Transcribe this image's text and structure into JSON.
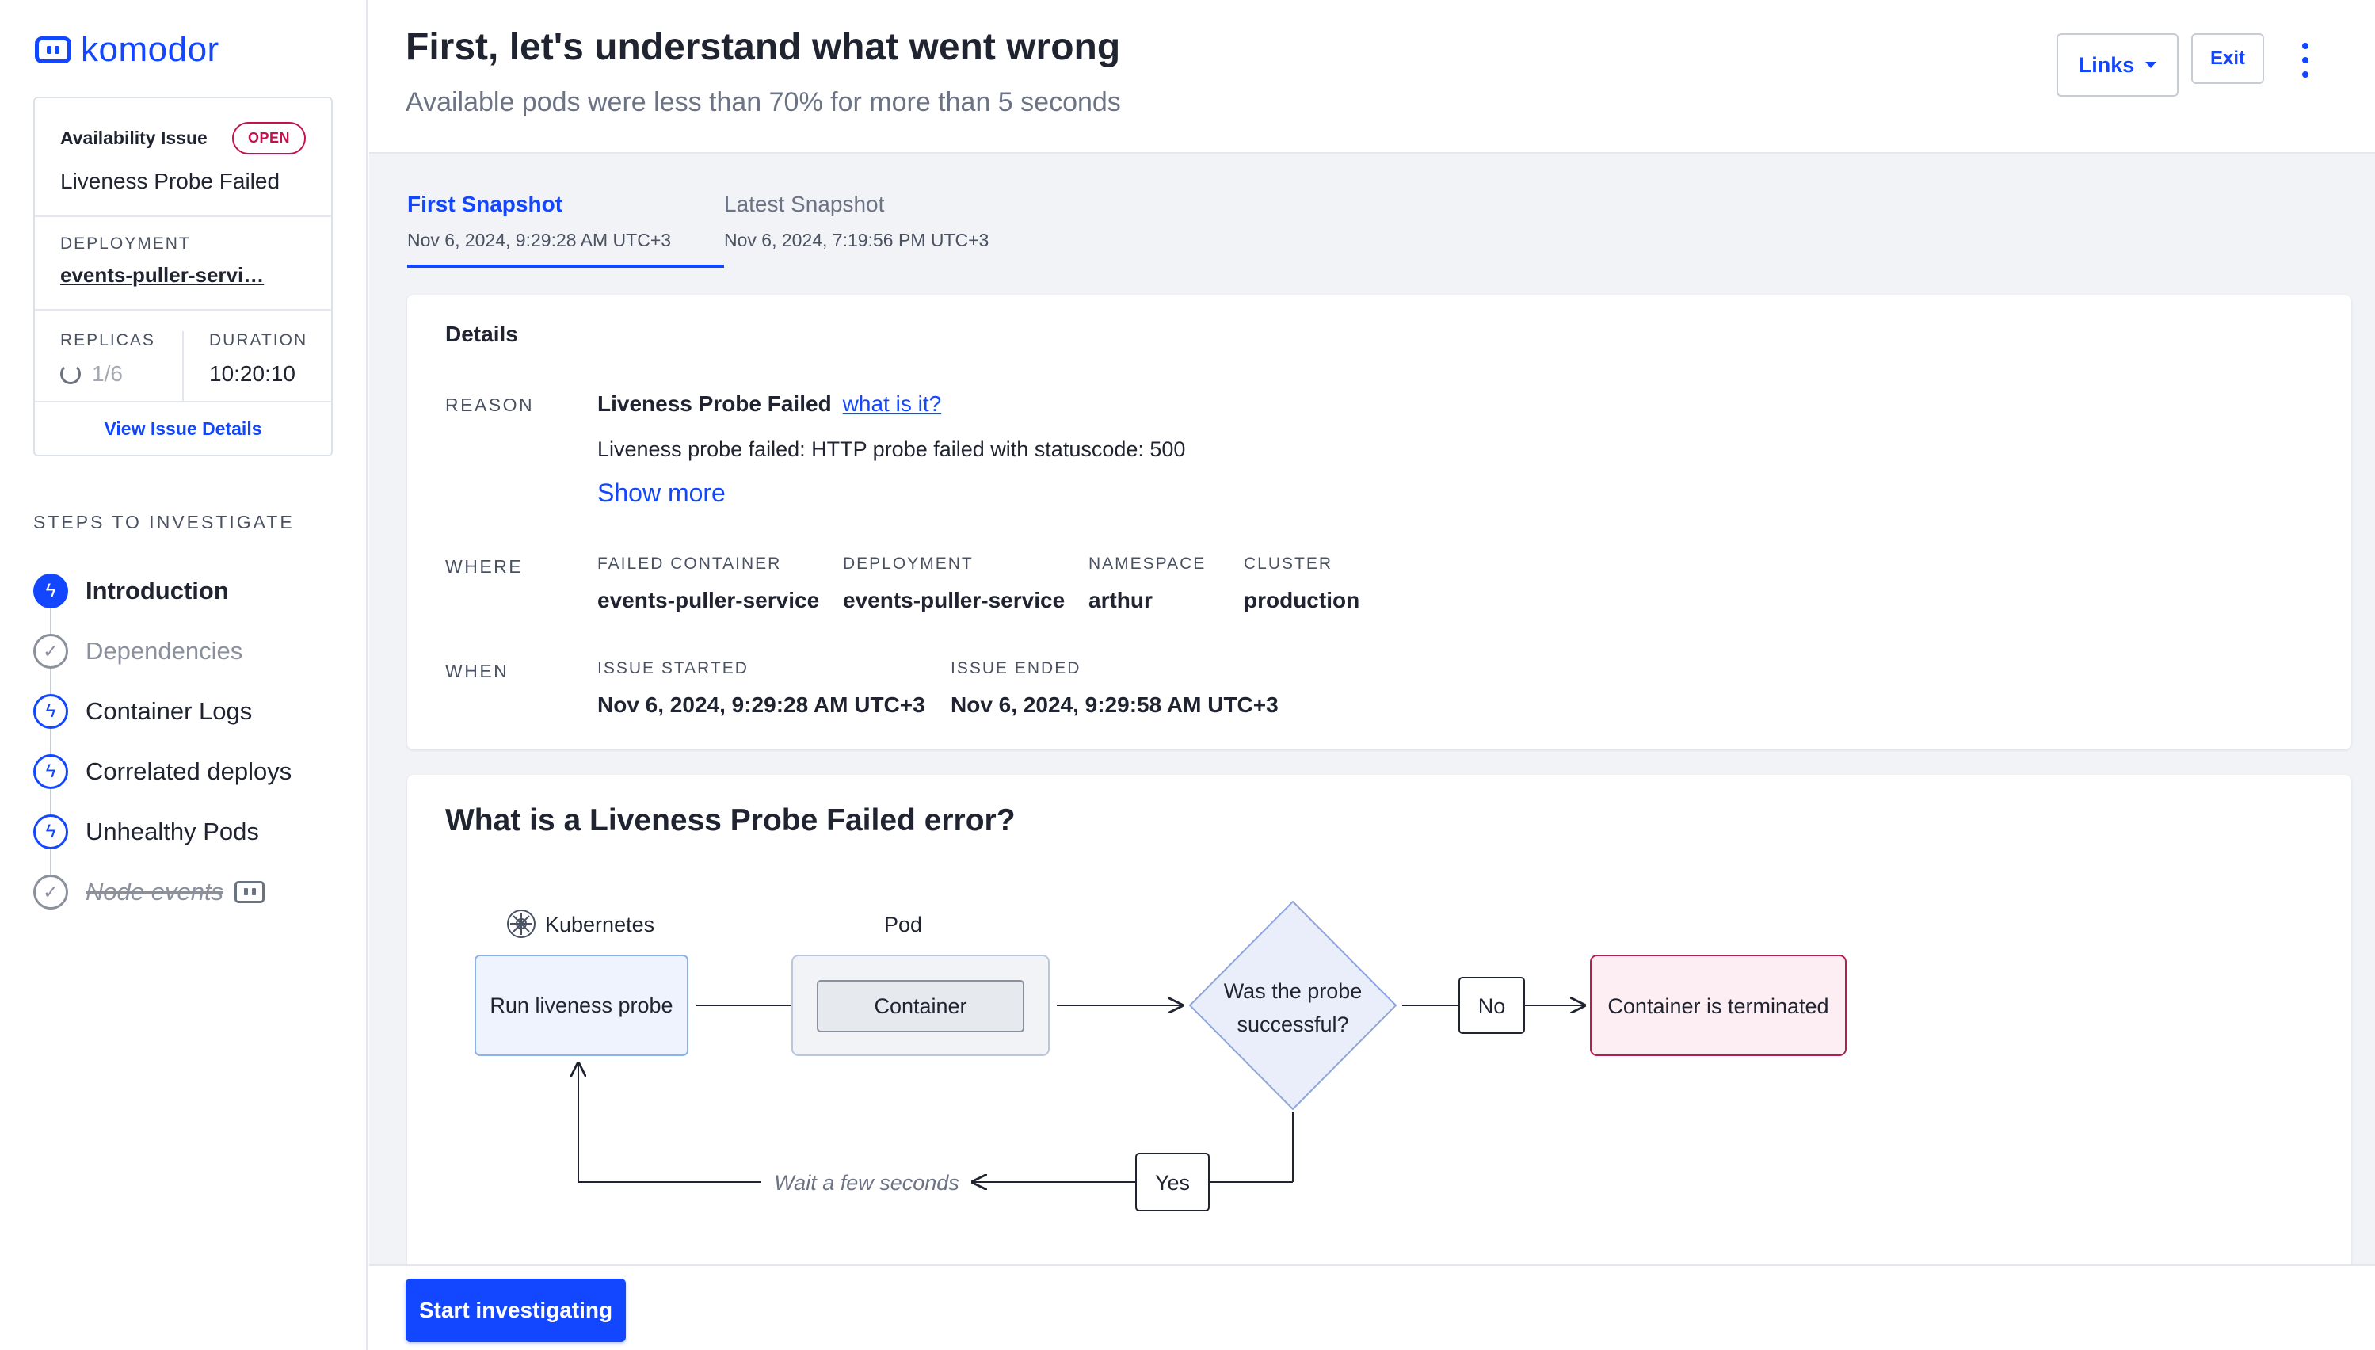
{
  "brand": {
    "name": "komodor"
  },
  "issue_card": {
    "type": "Availability Issue",
    "status": "OPEN",
    "title": "Liveness Probe Failed",
    "deployment_label": "DEPLOYMENT",
    "deployment_value": "events-puller-servi…",
    "replicas_label": "REPLICAS",
    "replicas_value": "1/6",
    "duration_label": "DURATION",
    "duration_value": "10:20:10",
    "view_details": "View Issue Details"
  },
  "steps": {
    "title": "STEPS TO INVESTIGATE",
    "items": [
      {
        "label": "Introduction",
        "state": "active",
        "icon": "bolt-icon"
      },
      {
        "label": "Dependencies",
        "state": "done",
        "icon": "check-circle-icon"
      },
      {
        "label": "Container Logs",
        "state": "pending",
        "icon": "bolt-icon"
      },
      {
        "label": "Correlated deploys",
        "state": "pending",
        "icon": "bolt-icon"
      },
      {
        "label": "Unhealthy Pods",
        "state": "pending",
        "icon": "bolt-icon"
      },
      {
        "label": "Node events",
        "state": "skipped",
        "icon": "check-circle-icon"
      }
    ]
  },
  "header": {
    "title": "First, let's understand what went wrong",
    "subtitle": "Available pods were less than 70% for more than 5 seconds",
    "links_label": "Links",
    "exit_label": "Exit"
  },
  "tabs": [
    {
      "name": "First Snapshot",
      "date": "Nov 6, 2024, 9:29:28 AM UTC+3",
      "active": true
    },
    {
      "name": "Latest Snapshot",
      "date": "Nov 6, 2024, 7:19:56 PM UTC+3",
      "active": false
    }
  ],
  "details": {
    "title": "Details",
    "reason_label": "REASON",
    "reason_value": "Liveness Probe Failed",
    "reason_link": "what is it?",
    "message": "Liveness probe failed: HTTP probe failed with statuscode: 500",
    "show_more": "Show more",
    "where_label": "WHERE",
    "where": [
      {
        "key": "FAILED CONTAINER",
        "value": "events-puller-service"
      },
      {
        "key": "DEPLOYMENT",
        "value": "events-puller-service"
      },
      {
        "key": "NAMESPACE",
        "value": "arthur"
      },
      {
        "key": "CLUSTER",
        "value": "production"
      }
    ],
    "when_label": "WHEN",
    "when": [
      {
        "key": "ISSUE STARTED",
        "value": "Nov 6, 2024, 9:29:28 AM UTC+3"
      },
      {
        "key": "ISSUE ENDED",
        "value": "Nov 6, 2024, 9:29:58 AM UTC+3"
      }
    ]
  },
  "explainer": {
    "title": "What is a Liveness Probe Failed error?",
    "kubernetes_label": "Kubernetes",
    "pod_label": "Pod",
    "run_probe": "Run liveness probe",
    "container": "Container",
    "question_line1": "Was the probe",
    "question_line2": "successful?",
    "no": "No",
    "yes": "Yes",
    "terminated": "Container is terminated",
    "wait": "Wait a few seconds"
  },
  "footer": {
    "start_label": "Start investigating"
  },
  "colors": {
    "accent": "#1347ff",
    "open_badge": "#c4124f",
    "terminated_fill": "#fdeef3"
  }
}
